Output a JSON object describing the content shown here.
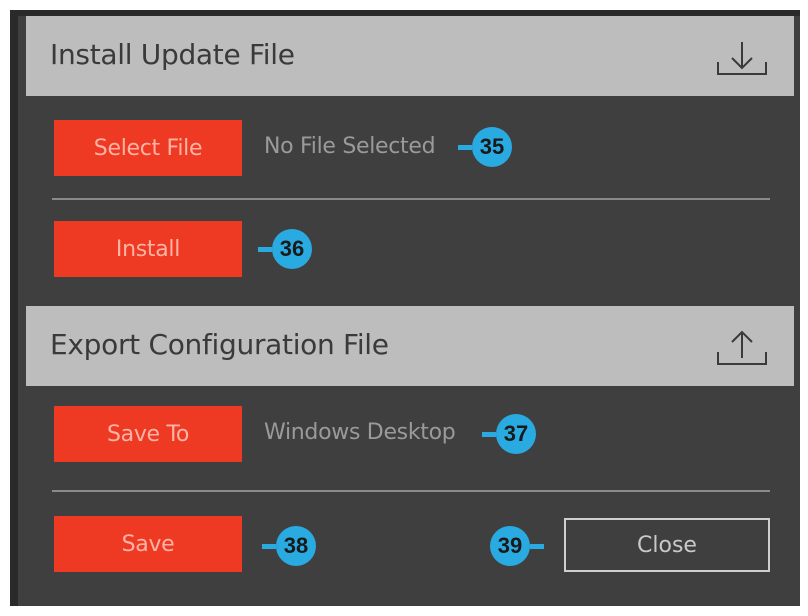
{
  "install_section": {
    "title": "Install Update File",
    "icon": "download-icon",
    "select_file_label": "Select File",
    "file_status": "No File Selected",
    "install_label": "Install"
  },
  "export_section": {
    "title": "Export Configuration File",
    "icon": "upload-icon",
    "save_to_label": "Save To",
    "destination": "Windows Desktop"
  },
  "footer": {
    "save_label": "Save",
    "close_label": "Close"
  },
  "callouts": {
    "c35": "35",
    "c36": "36",
    "c37": "37",
    "c38": "38",
    "c39": "39"
  },
  "colors": {
    "accent": "#ee3a22",
    "callout": "#29abe2",
    "header_bg": "#bdbdbd",
    "panel_bg": "#3f3f3f"
  }
}
